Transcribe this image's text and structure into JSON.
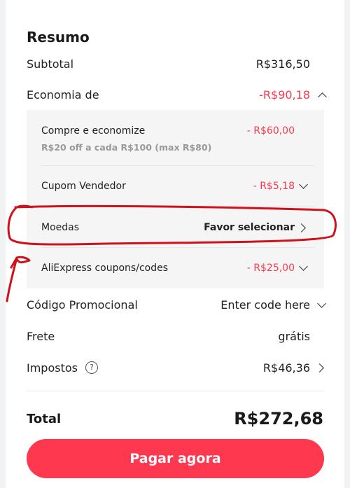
{
  "summary": {
    "title": "Resumo",
    "subtotal_label": "Subtotal",
    "subtotal_value": "R$316,50",
    "savings_label": "Economia de",
    "savings_value": "-R$90,18",
    "savings_details": {
      "buy_save_label": "Compre e economize",
      "buy_save_note": "R$20 off a cada R$100 (max R$80)",
      "buy_save_value": "- R$60,00",
      "seller_coupon_label": "Cupom Vendedor",
      "seller_coupon_value": "- R$5,18",
      "coins_label": "Moedas",
      "coins_value": "Favor selecionar",
      "ae_coupons_label": "AliExpress coupons/codes",
      "ae_coupons_value": "- R$25,00"
    },
    "promo_code_label": "Código Promocional",
    "promo_code_value": "Enter code here",
    "shipping_label": "Frete",
    "shipping_value": "grátis",
    "taxes_label": "Impostos",
    "taxes_help_glyph": "?",
    "taxes_value": "R$46,36",
    "total_label": "Total",
    "total_value": "R$272,68",
    "pay_button_label": "Pagar agora"
  },
  "colors": {
    "accent": "#fd384f",
    "annotation": "#d0101a"
  }
}
